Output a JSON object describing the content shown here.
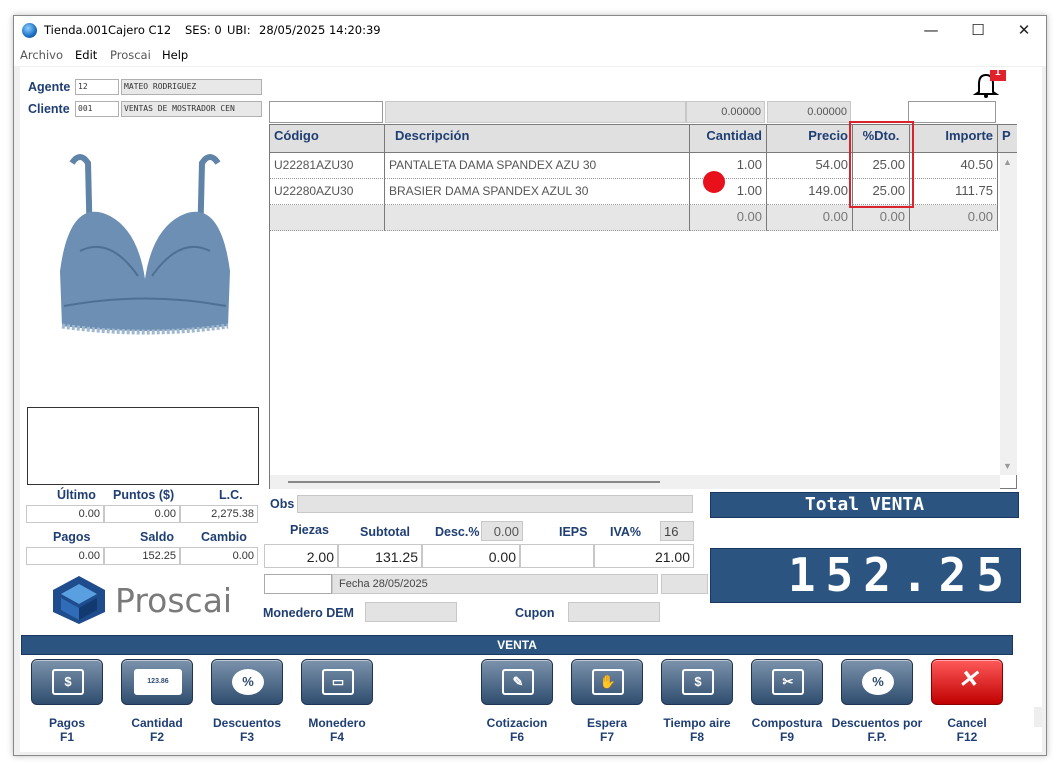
{
  "titlebar": {
    "store": "Tienda.001",
    "cashier": "Cajero C12",
    "session": "SES: 0",
    "location": "UBI:",
    "datetime": "28/05/2025 14:20:39"
  },
  "menu": [
    "Archivo",
    "Edit",
    "Proscai",
    "Help"
  ],
  "notification_count": "1",
  "agent": {
    "label": "Agente",
    "code": "12",
    "name": "MATEO RODRIGUEZ"
  },
  "client": {
    "label": "Cliente",
    "code": "001",
    "name": "VENTAS DE MOSTRADOR CEN"
  },
  "top_values": [
    "0.00000",
    "0.00000"
  ],
  "grid": {
    "headers": [
      "Código",
      "Descripción",
      "Cantidad",
      "Precio",
      "%Dto.",
      "Importe",
      "P"
    ],
    "rows": [
      {
        "code": "U22281AZU30",
        "desc": "PANTALETA DAMA SPANDEX AZU 30",
        "qty": "1.00",
        "price": "54.00",
        "disc": "25.00",
        "amount": "40.50"
      },
      {
        "code": "U22280AZU30",
        "desc": "BRASIER DAMA SPANDEX AZUL 30",
        "qty": "1.00",
        "price": "149.00",
        "disc": "25.00",
        "amount": "111.75"
      },
      {
        "code": "",
        "desc": "",
        "qty": "0.00",
        "price": "0.00",
        "disc": "0.00",
        "amount": "0.00"
      }
    ]
  },
  "credit": {
    "ultimo_label": "Último",
    "puntos_label": "Puntos ($)",
    "lc_label": "L.C.",
    "ultimo": "0.00",
    "puntos": "0.00",
    "lc": "2,275.38"
  },
  "balance": {
    "pagos_label": "Pagos",
    "saldo_label": "Saldo",
    "cambio_label": "Cambio",
    "pagos": "0.00",
    "saldo": "152.25",
    "cambio": "0.00"
  },
  "brand": "Proscai",
  "obs_label": "Obs",
  "summary": {
    "piezas_label": "Piezas",
    "subtotal_label": "Subtotal",
    "desc_label": "Desc.%",
    "desc_pct": "0.00",
    "ieps_label": "IEPS",
    "iva_label": "IVA%",
    "iva_pct": "16",
    "piezas": "2.00",
    "subtotal": "131.25",
    "desc": "0.00",
    "ieps": "",
    "iva": "21.00"
  },
  "fecha": "Fecha 28/05/2025",
  "monedero_label": "Monedero DEM",
  "cupon_label": "Cupon",
  "total": {
    "label": "Total VENTA",
    "value": "152.25"
  },
  "section_title": "VENTA",
  "buttons": [
    {
      "id": "pagos",
      "name": "Pagos",
      "key": "F1",
      "glyph": "$"
    },
    {
      "id": "cantidad",
      "name": "Cantidad",
      "key": "F2",
      "glyph": "123.86"
    },
    {
      "id": "descuentos",
      "name": "Descuentos",
      "key": "F3",
      "glyph": "%"
    },
    {
      "id": "monedero",
      "name": "Monedero",
      "key": "F4",
      "glyph": "▭"
    },
    {
      "id": "cotizacion",
      "name": "Cotizacion",
      "key": "F6",
      "glyph": "✎"
    },
    {
      "id": "espera",
      "name": "Espera",
      "key": "F7",
      "glyph": "✋"
    },
    {
      "id": "tiempo-aire",
      "name": "Tiempo aire",
      "key": "F8",
      "glyph": "$"
    },
    {
      "id": "compostura",
      "name": "Compostura",
      "key": "F9",
      "glyph": "✂"
    },
    {
      "id": "descuentos-fp",
      "name": "Descuentos por",
      "name2": "F.P.",
      "glyph": "%"
    },
    {
      "id": "cancel",
      "name": "Cancel",
      "key": "F12",
      "glyph": "✕"
    }
  ],
  "colors": {
    "accent": "#1f3e72",
    "bar": "#2b5580",
    "highlight": "#e0212a"
  }
}
